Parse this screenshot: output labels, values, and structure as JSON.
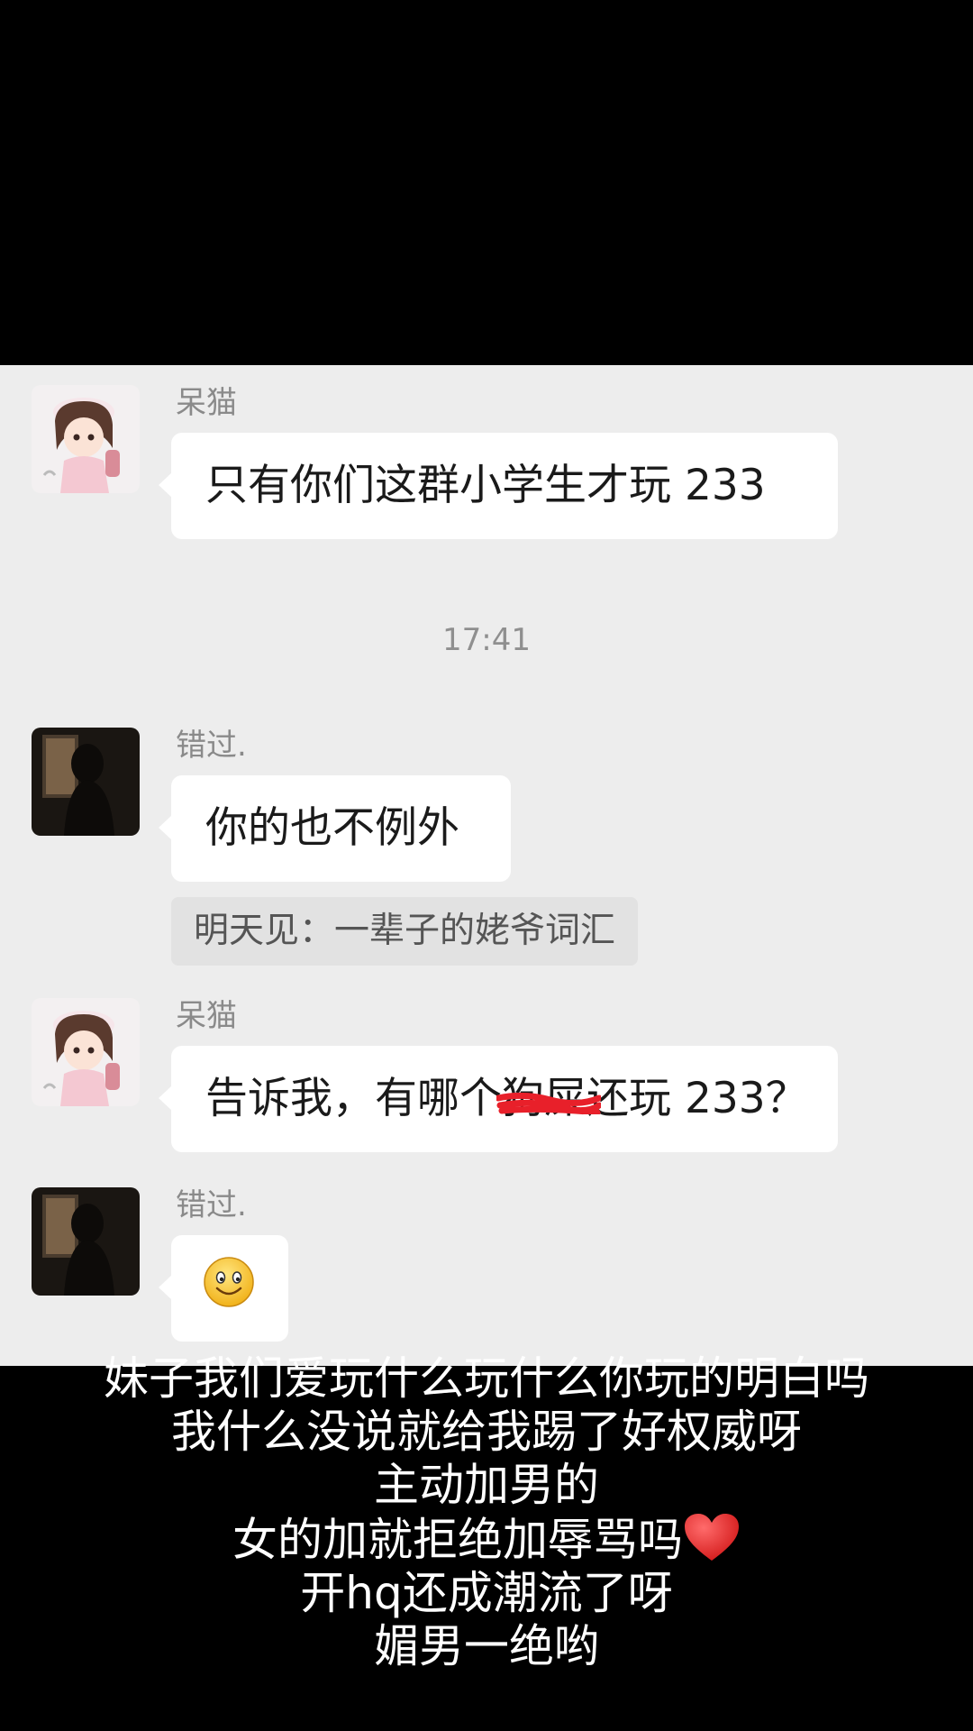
{
  "messages": [
    {
      "sender": "呆猫",
      "text": "只有你们这群小学生才玩 233"
    },
    {
      "sender": "错过.",
      "text": "你的也不例外",
      "quote": "明天见：一辈子的姥爷词汇"
    },
    {
      "sender": "呆猫",
      "text_before": "告诉我，有哪个",
      "text_redacted": "狗屎",
      "text_after": "还玩 233？"
    },
    {
      "sender": "错过.",
      "emoji": "smiley-emoji"
    }
  ],
  "timestamp": "17:41",
  "caption": {
    "lines": [
      "妹子我们爱玩什么玩什么你玩的明白吗",
      "我什么没说就给我踢了好权威呀",
      "主动加男的",
      "女的加就拒绝加辱骂吗",
      "开hq还成潮流了呀",
      "媚男一绝哟"
    ],
    "heart_icon": "red-heart-emoji"
  },
  "colors": {
    "chat_background": "#ededed",
    "bubble": "#ffffff",
    "scribble": "#e8202a",
    "caption_text": "#ffffff"
  }
}
